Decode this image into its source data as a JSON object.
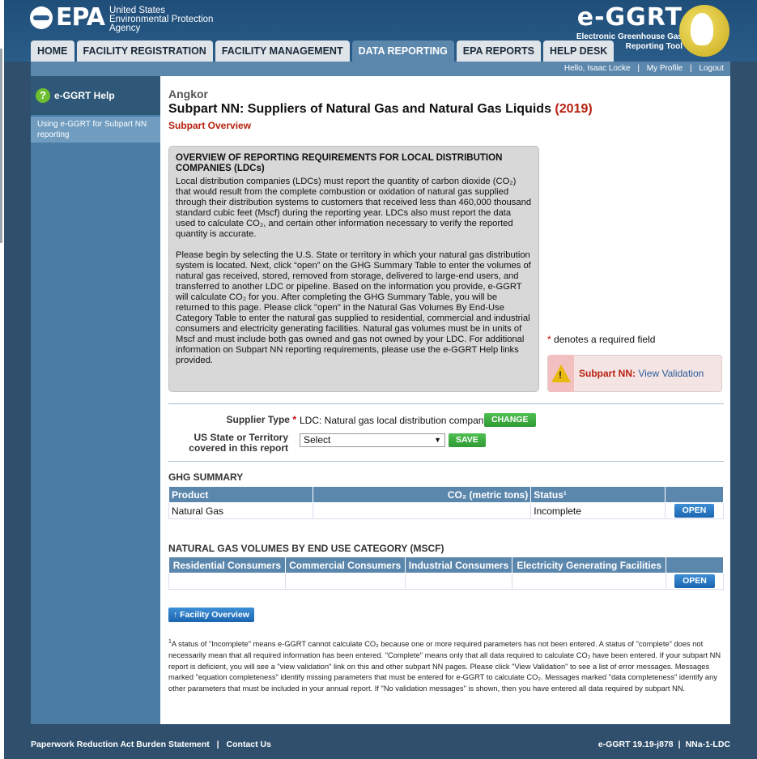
{
  "header": {
    "agency_lines": [
      "United States",
      "Environmental Protection",
      "Agency"
    ],
    "logo_text": "EPA",
    "brand_big": "e-GGRT",
    "brand_small_1": "Electronic Greenhouse Gas",
    "brand_small_2": "Reporting Tool"
  },
  "tabs": [
    {
      "label": "HOME"
    },
    {
      "label": "FACILITY REGISTRATION"
    },
    {
      "label": "FACILITY MANAGEMENT"
    },
    {
      "label": "DATA REPORTING"
    },
    {
      "label": "EPA REPORTS"
    },
    {
      "label": "HELP DESK"
    }
  ],
  "userbar": {
    "greeting": "Hello, Isaac Locke",
    "profile": "My Profile",
    "logout": "Logout",
    "sep": "|"
  },
  "sidebar": {
    "help_title": "e-GGRT Help",
    "help_link": "Using e-GGRT for Subpart NN reporting"
  },
  "main": {
    "facility": "Angkor",
    "title": "Subpart NN: Suppliers of Natural Gas and Natural Gas Liquids",
    "year": "(2019)",
    "subtitle": "Subpart Overview"
  },
  "overview": {
    "heading": "OVERVIEW OF REPORTING REQUIREMENTS FOR LOCAL DISTRIBUTION COMPANIES (LDCs)",
    "p1": "Local distribution companies (LDCs) must report the quantity of carbon dioxide (CO₂) that would result from the complete combustion or oxidation of natural gas supplied through their distribution systems to customers that received less than 460,000 thousand standard cubic feet (Mscf) during the reporting year. LDCs also must report the data used to calculate CO₂, and certain other information necessary to verify the reported quantity is accurate.",
    "p2": "Please begin by selecting the U.S. State or territory in which your natural gas distribution system is located. Next, click “open” on the GHG Summary Table to enter the volumes of natural gas received, stored, removed from storage, delivered to large-end users, and transferred to another LDC or pipeline. Based on the information you provide, e-GGRT will calculate CO₂ for you. After completing the GHG Summary Table, you will be returned to this page. Please click \"open\" in the Natural Gas Volumes By End-Use Category Table to enter the natural gas supplied to residential, commercial and industrial consumers and electricity generating facilities. Natural gas volumes must be in units of Mscf and must include both gas owned and gas not owned by your LDC. For additional information on Subpart NN reporting requirements, please use the e-GGRT Help links provided."
  },
  "required_note": "denotes a required field",
  "validation": {
    "label": "Subpart NN:",
    "link": "View Validation"
  },
  "form": {
    "supplier_label": "Supplier Type",
    "supplier_value": "LDC: Natural gas local distribution company",
    "change": "CHANGE",
    "state_label_1": "US State or Territory",
    "state_label_2": "covered in this report",
    "state_value": "Select",
    "save": "SAVE"
  },
  "ghg": {
    "title": "GHG SUMMARY",
    "headers": [
      "Product",
      "CO₂ (metric tons)",
      "Status¹",
      ""
    ],
    "row": [
      "Natural Gas",
      "",
      "Incomplete"
    ],
    "open": "OPEN"
  },
  "volumes": {
    "title": "NATURAL GAS VOLUMES BY END USE CATEGORY (MSCF)",
    "headers": [
      "Residential Consumers",
      "Commercial Consumers",
      "Industrial Consumers",
      "Electricity Generating Facilities",
      ""
    ],
    "open": "OPEN"
  },
  "facility_overview": "↑ Facility Overview",
  "footnote": "A status of \"Incomplete\" means e-GGRT cannot calculate CO₂ because one or more required parameters has not been entered. A status of \"complete\" does not necessarily mean that all required information has been entered. \"Complete\" means only that all data required to calculate CO₂ have been entered. If your subpart NN report is deficient, you will see a \"view validation\" link on this and other subpart NN pages. Please click \"View Validation\" to see a list of error messages. Messages marked \"equation completeness\" identify missing parameters that must be entered for e-GGRT to calculate CO₂. Messages marked \"data completeness\" identify any other parameters that must be included in your annual report. If \"No validation messages\" is shown, then you have entered all data required by subpart NN.",
  "footnote_mark": "1",
  "footer": {
    "paperwork": "Paperwork Reduction Act Burden Statement",
    "contact": "Contact Us",
    "version": "e-GGRT 19.19-j878",
    "code": "NNa-1-LDC",
    "sep": "|"
  }
}
